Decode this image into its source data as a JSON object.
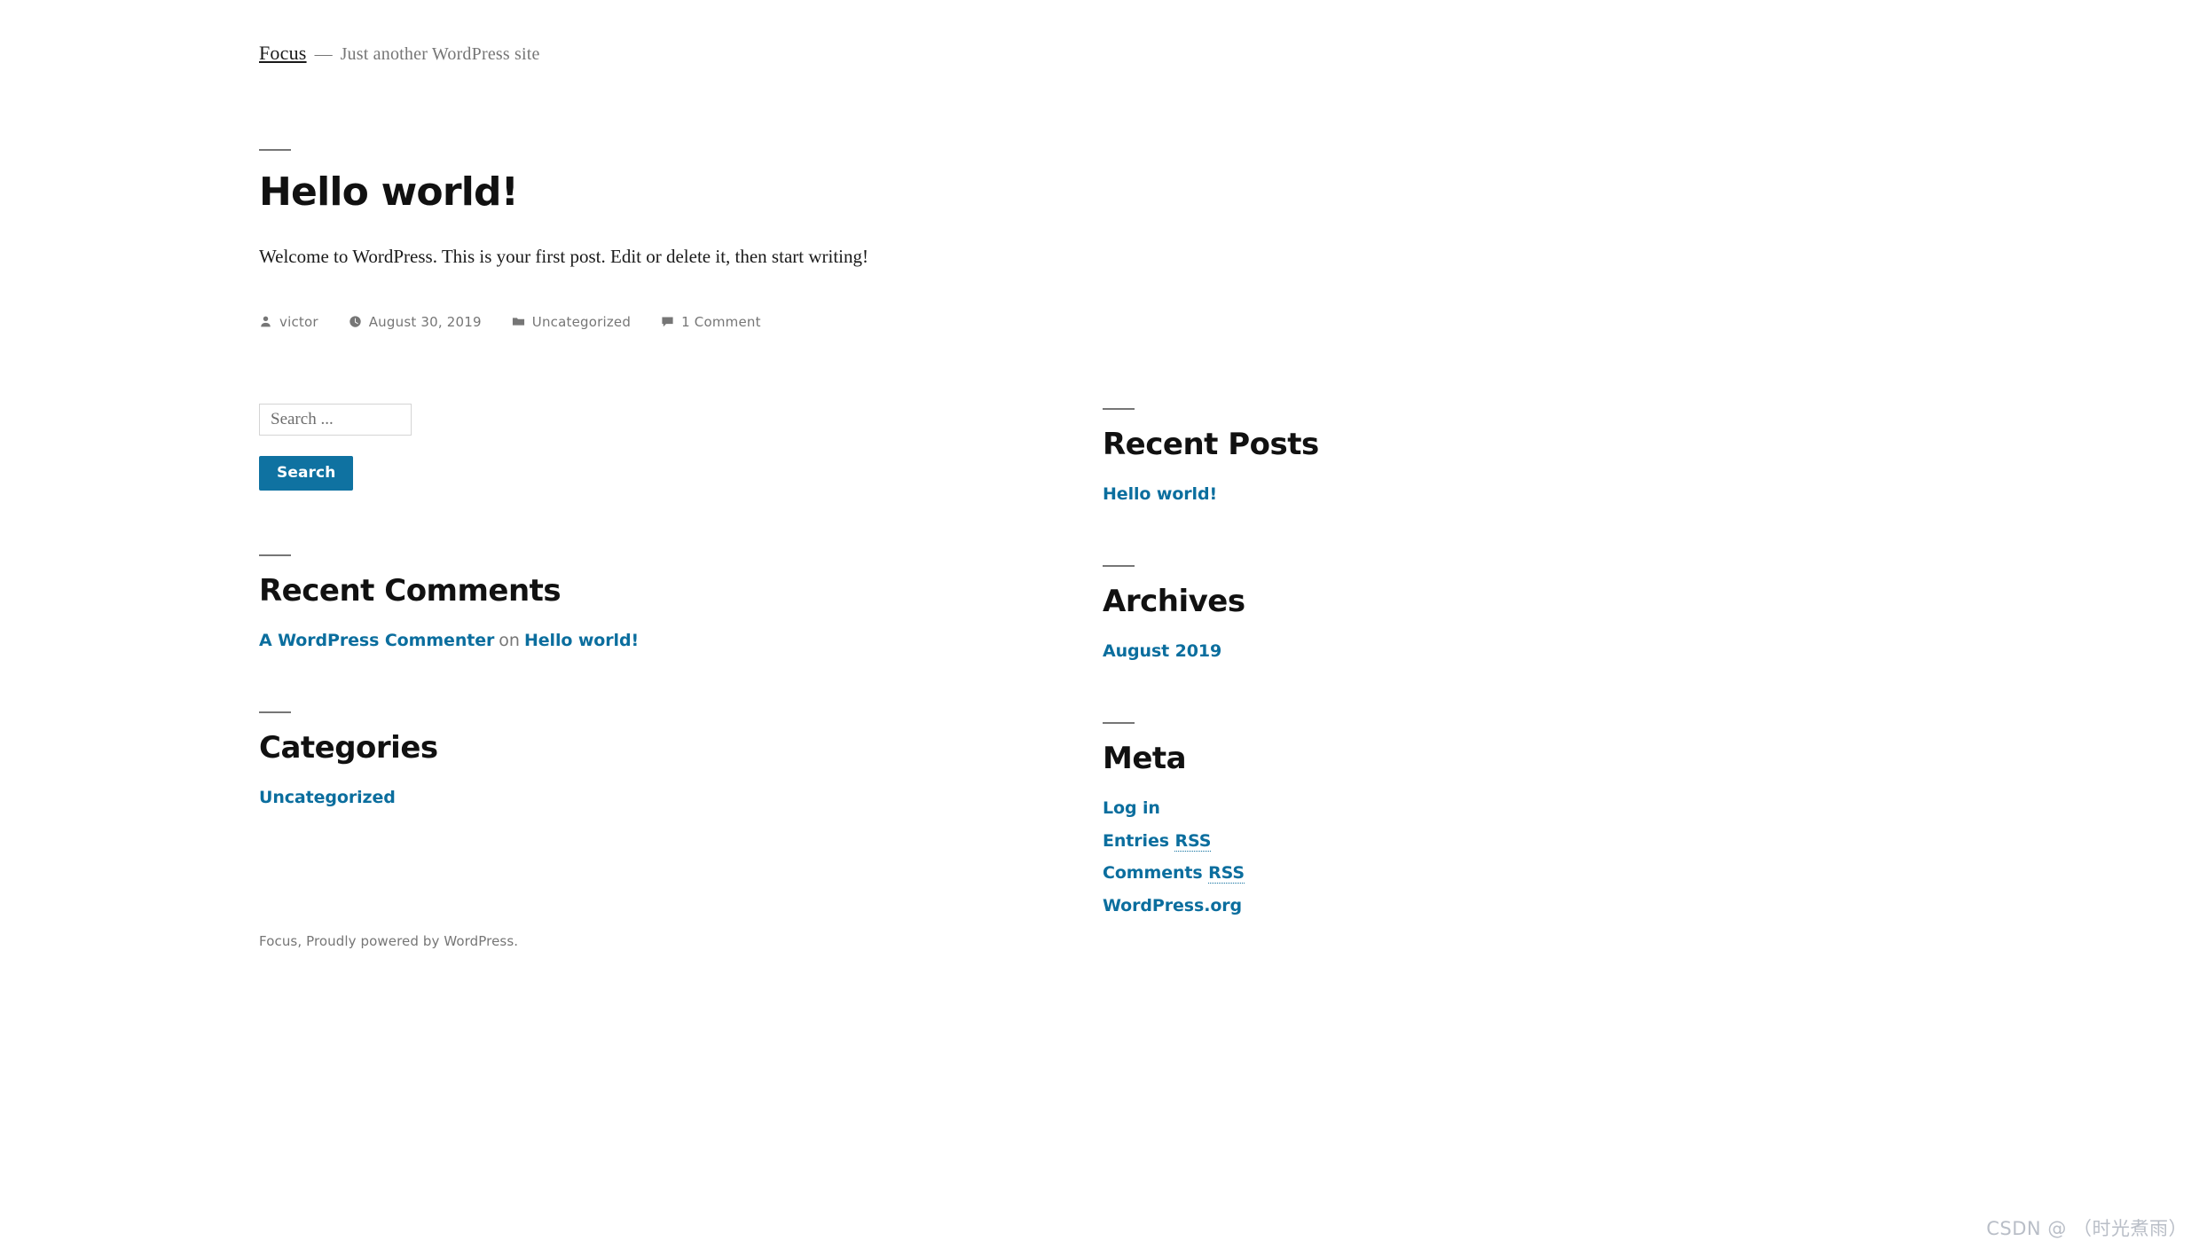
{
  "site": {
    "title": "Focus",
    "separator": "—",
    "description": "Just another WordPress site"
  },
  "post": {
    "title": "Hello world!",
    "content": "Welcome to WordPress. This is your first post. Edit or delete it, then start writing!",
    "meta": {
      "author_icon": "person-icon",
      "author": "victor",
      "date_icon": "clock-icon",
      "date": "August 30, 2019",
      "category_icon": "folder-icon",
      "category": "Uncategorized",
      "comments_icon": "comment-icon",
      "comments": "1 Comment"
    }
  },
  "widgets": {
    "search": {
      "placeholder": "Search ...",
      "value": "",
      "button_label": "Search"
    },
    "recent_comments": {
      "title": "Recent Comments",
      "items": [
        {
          "author": "A WordPress Commenter",
          "connector": "on",
          "post": "Hello world!"
        }
      ]
    },
    "categories": {
      "title": "Categories",
      "items": [
        "Uncategorized"
      ]
    },
    "recent_posts": {
      "title": "Recent Posts",
      "items": [
        "Hello world!"
      ]
    },
    "archives": {
      "title": "Archives",
      "items": [
        "August 2019"
      ]
    },
    "meta": {
      "title": "Meta",
      "items": [
        {
          "text": "Log in",
          "abbr": ""
        },
        {
          "text": "Entries ",
          "abbr": "RSS"
        },
        {
          "text": "Comments ",
          "abbr": "RSS"
        },
        {
          "text": "WordPress.org",
          "abbr": ""
        }
      ]
    }
  },
  "footer": {
    "text": "Focus, Proudly powered by WordPress."
  },
  "watermark": {
    "text": "CSDN @ （时光煮雨）"
  },
  "colors": {
    "link": "#0b6e9e",
    "button": "#0f72a1",
    "muted": "#767676",
    "text": "#111111"
  }
}
